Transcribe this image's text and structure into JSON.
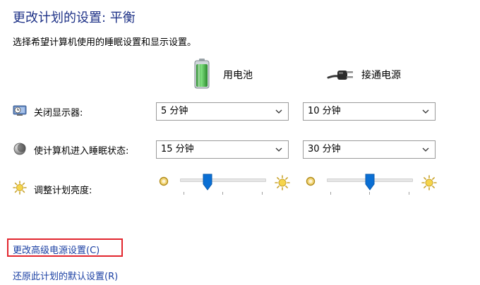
{
  "page": {
    "title": "更改计划的设置: 平衡",
    "subtitle": "选择希望计算机使用的睡眠设置和显示设置。"
  },
  "columns": {
    "battery": "用电池",
    "plugged": "接通电源"
  },
  "rows": {
    "display_off": {
      "label": "关闭显示器:",
      "battery_value": "5 分钟",
      "plugged_value": "10 分钟"
    },
    "sleep": {
      "label": "使计算机进入睡眠状态:",
      "battery_value": "15 分钟",
      "plugged_value": "30 分钟"
    },
    "brightness": {
      "label": "调整计划亮度:",
      "battery_level": 0.3,
      "plugged_level": 0.5
    }
  },
  "links": {
    "advanced": "更改高级电源设置(C)",
    "restore": "还原此计划的默认设置(R)"
  },
  "colors": {
    "title": "#1e3287",
    "link": "#1a3fa3",
    "slider_thumb": "#0a6fd4",
    "highlight_box": "#e2262e",
    "battery_green": "#3db23f"
  },
  "icons": {
    "battery": "battery-icon",
    "plug": "power-plug-icon",
    "display": "monitor-clock-icon",
    "sleep": "moon-sleep-icon",
    "brightness": "sun-icon"
  }
}
